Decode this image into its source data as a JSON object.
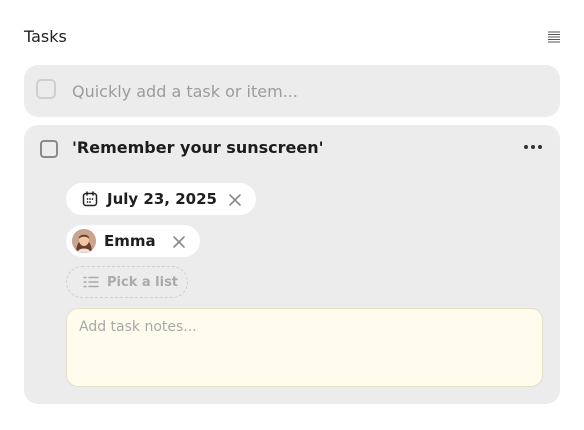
{
  "header": {
    "title": "Tasks",
    "view_icon": "list-lines-icon"
  },
  "quick_add": {
    "placeholder": "Quickly add a task or item...",
    "checkbox_icon": "checkbox-empty-icon"
  },
  "task": {
    "title": "'Remember your sunscreen'",
    "completed": false,
    "more_icon": "more-horizontal-icon",
    "date": {
      "icon": "calendar-icon",
      "label": "July 23, 2025",
      "remove_icon": "close-icon"
    },
    "assignee": {
      "icon": "avatar",
      "label": "Emma",
      "remove_icon": "close-icon"
    },
    "list": {
      "icon": "list-icon",
      "label": "Pick a list"
    },
    "notes": {
      "placeholder": "Add task notes..."
    }
  },
  "colors": {
    "card_bg": "#ececec",
    "chip_bg": "#ffffff",
    "notes_bg": "#fffcee",
    "text": "#1f1f1f",
    "muted": "#9c9c9c"
  }
}
